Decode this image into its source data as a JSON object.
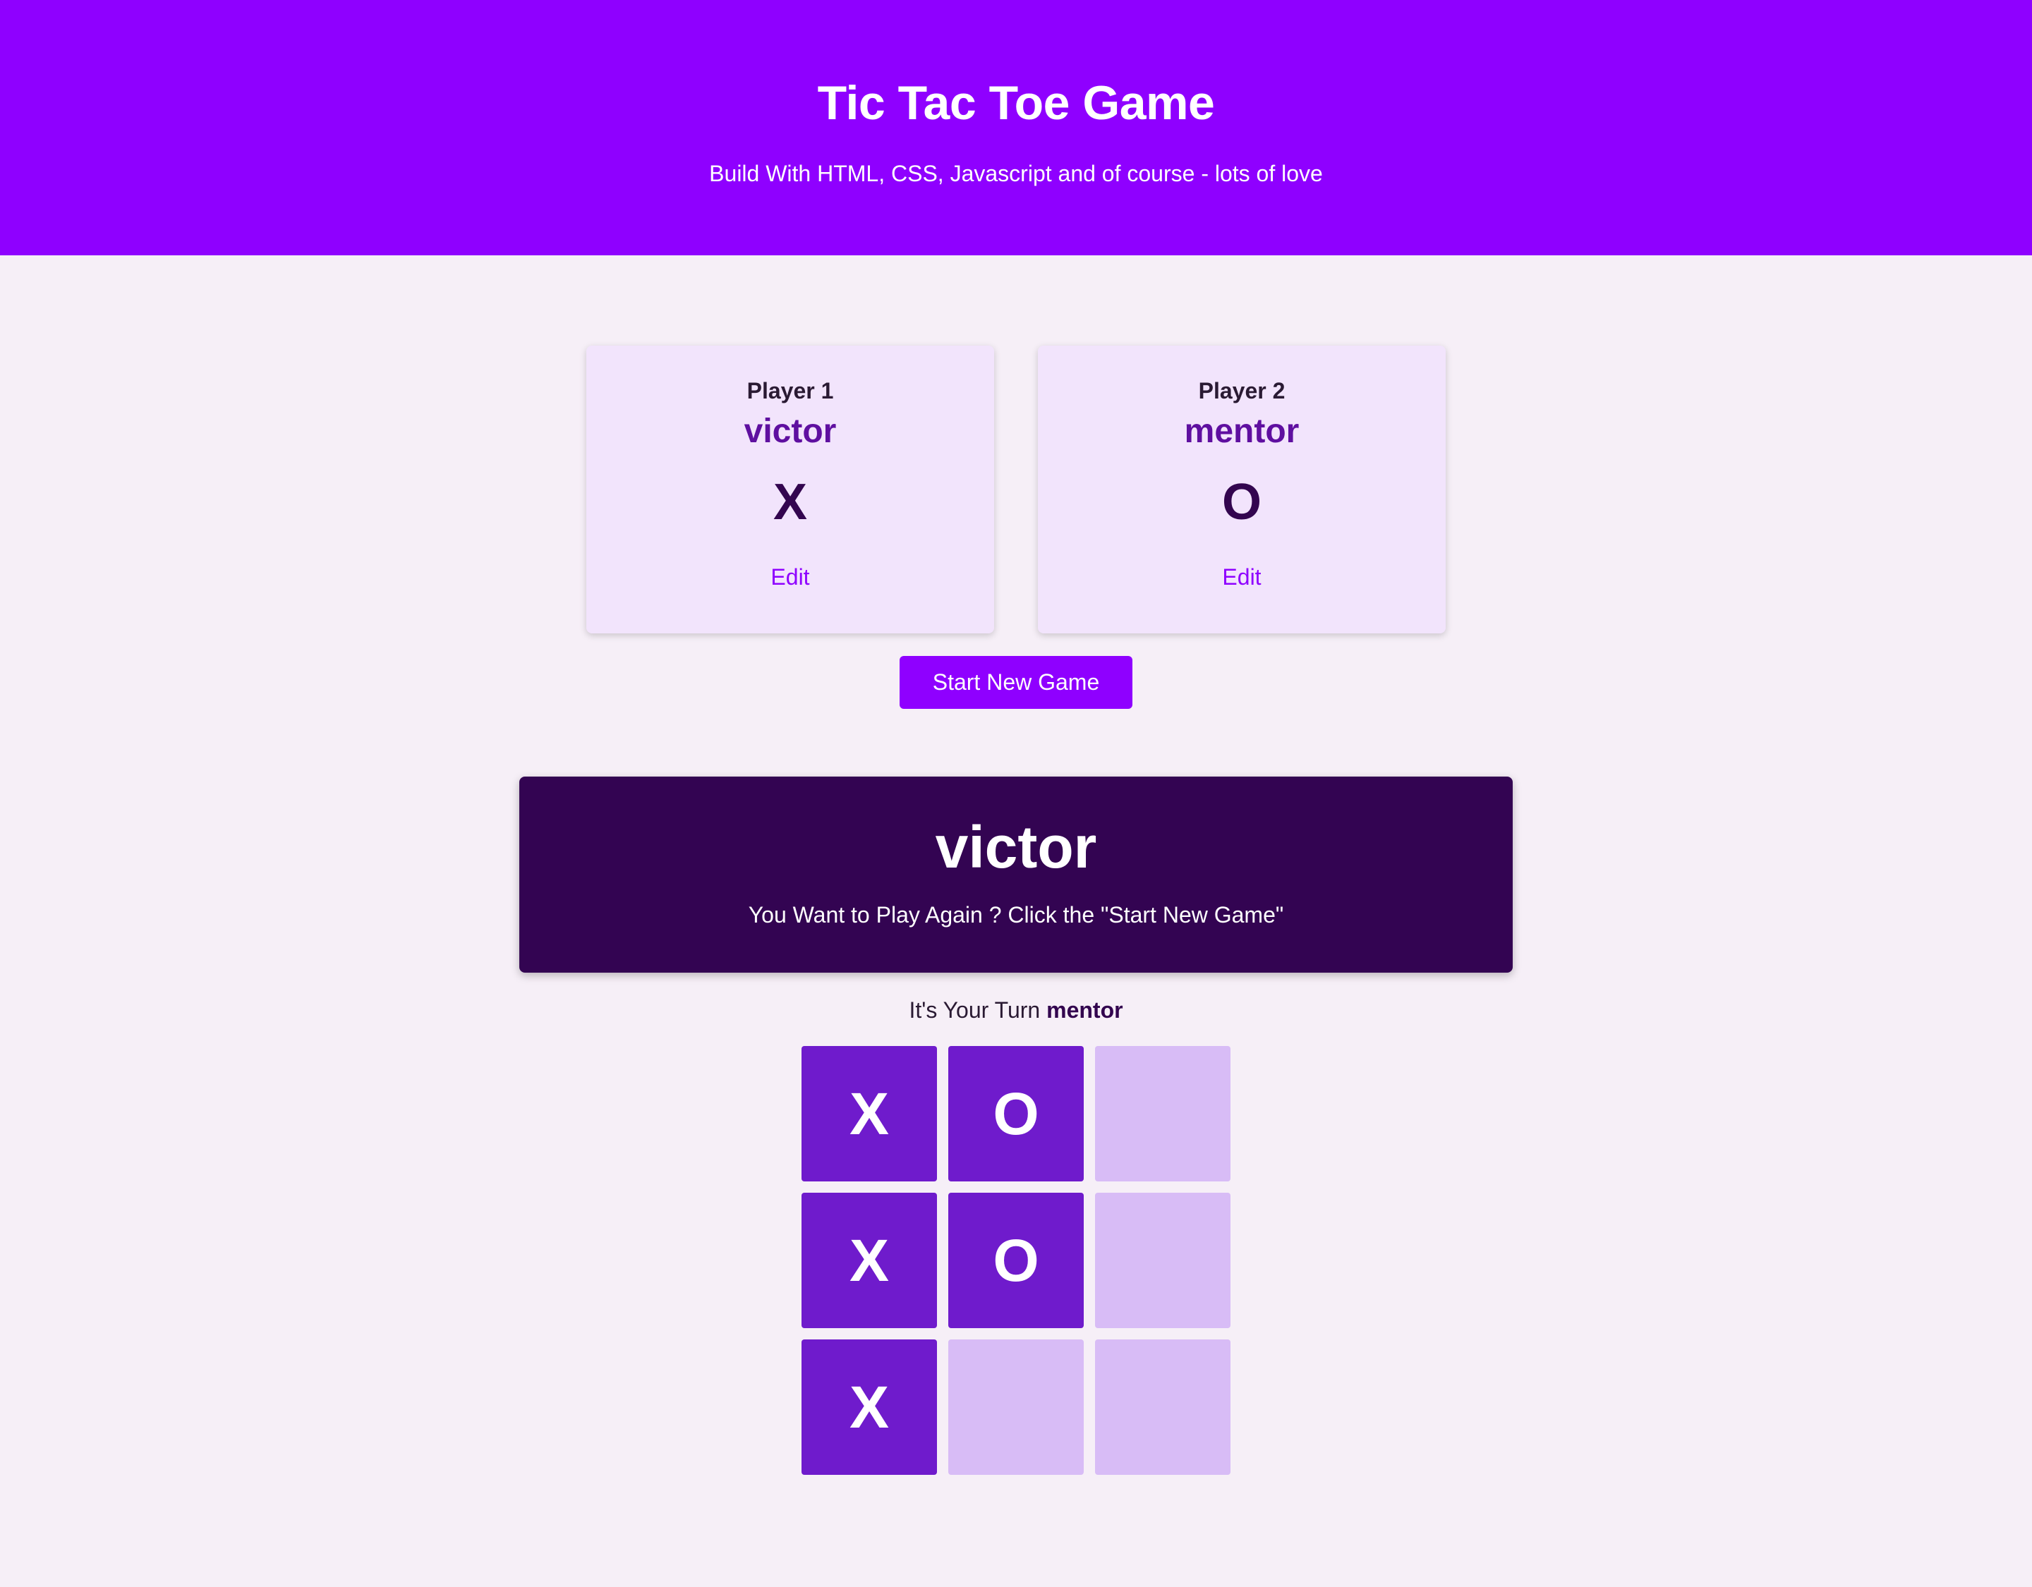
{
  "header": {
    "title": "Tic Tac Toe Game",
    "subtitle": "Build With HTML, CSS, Javascript and of course - lots of love"
  },
  "players": [
    {
      "label": "Player 1",
      "name": "victor",
      "symbol": "X",
      "edit_label": "Edit"
    },
    {
      "label": "Player 2",
      "name": "mentor",
      "symbol": "O",
      "edit_label": "Edit"
    }
  ],
  "start_button": {
    "label": "Start New Game"
  },
  "game_over": {
    "winner_name": "victor",
    "message": "You Want to Play Again ? Click the \"Start New Game\""
  },
  "turn": {
    "prefix": "It's Your Turn",
    "player": "mentor"
  },
  "board": {
    "cells": [
      "X",
      "O",
      "",
      "X",
      "O",
      "",
      "X",
      "",
      ""
    ]
  },
  "colors": {
    "header_bg": "#8f00ff",
    "page_bg": "#f6eff7",
    "card_bg": "#f2e4fc",
    "accent": "#8f00ff",
    "dark": "#330452",
    "cell_filled": "#6f1bcc",
    "cell_empty": "#d8bcf6"
  }
}
